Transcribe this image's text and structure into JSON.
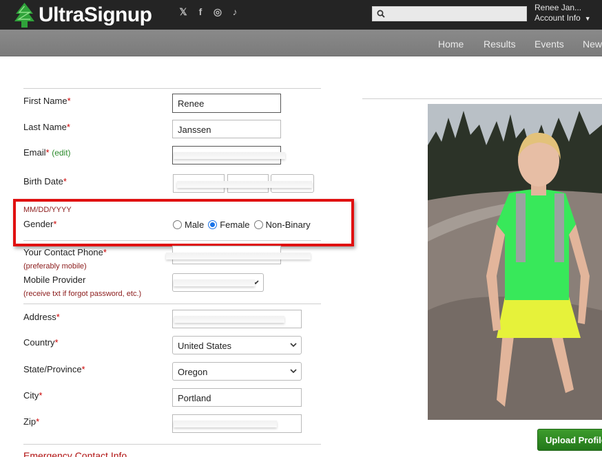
{
  "header": {
    "brand": "UltraSignup",
    "social_icons": [
      "twitter-icon",
      "facebook-icon",
      "instagram-icon",
      "tiktok-icon"
    ],
    "social_glyphs": [
      "𝕏",
      "f",
      "◎",
      "♪"
    ],
    "search": {
      "placeholder": ""
    },
    "account": {
      "name": "Renee Jan...",
      "label": "Account Info"
    }
  },
  "nav": {
    "items": [
      "Home",
      "Results",
      "Events",
      "New"
    ]
  },
  "form": {
    "first_name": {
      "label": "First Name",
      "value": "Renee"
    },
    "last_name": {
      "label": "Last Name",
      "value": "Janssen"
    },
    "email": {
      "label": "Email",
      "edit": "(edit)"
    },
    "birth_date": {
      "label": "Birth Date",
      "hint": "MM/DD/YYYY"
    },
    "gender": {
      "label": "Gender",
      "options": [
        "Male",
        "Female",
        "Non-Binary"
      ],
      "selected": "Female"
    },
    "contact_phone": {
      "label": "Your Contact Phone",
      "hint": "(preferably mobile)"
    },
    "mobile_provider": {
      "label": "Mobile Provider",
      "hint": "(receive txt if forgot password, etc.)"
    },
    "address": {
      "label": "Address"
    },
    "country": {
      "label": "Country",
      "value": "United States"
    },
    "state": {
      "label": "State/Province",
      "value": "Oregon"
    },
    "city": {
      "label": "City",
      "value": "Portland"
    },
    "zip": {
      "label": "Zip"
    },
    "required_mark": "*",
    "emergency_heading": "Emergency Contact Info"
  },
  "profile": {
    "upload_label": "Upload Profile"
  },
  "colors": {
    "header_bg": "#242424",
    "nav_bg": "#808080",
    "required": "#cc0000",
    "hint": "#8b1a1a",
    "highlight": "#e01010",
    "upload_button": "#2e8b22"
  }
}
